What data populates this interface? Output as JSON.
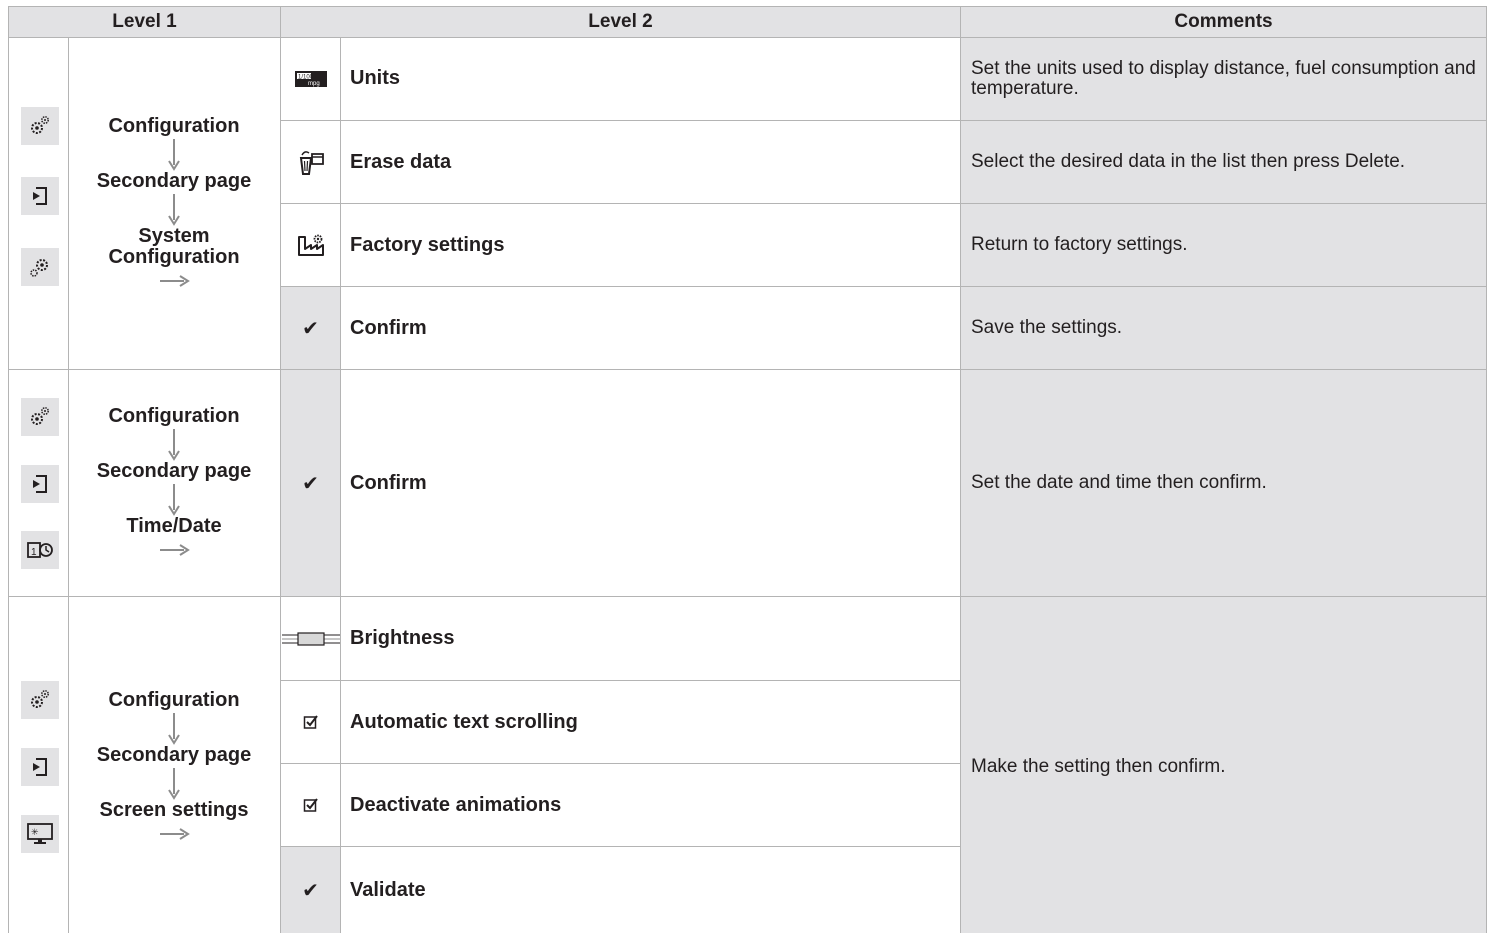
{
  "headers": {
    "level1": "Level 1",
    "level2": "Level 2",
    "comments": "Comments"
  },
  "sections": [
    {
      "path": [
        "Configuration",
        "Secondary page",
        "System Configuration"
      ],
      "icons": [
        "gear-cog-icon",
        "enter-page-icon",
        "system-gears-icon"
      ],
      "rows": [
        {
          "icon": "units-mpg-icon",
          "label": "Units"
        },
        {
          "icon": "erase-data-icon",
          "label": "Erase data"
        },
        {
          "icon": "factory-settings-icon",
          "label": "Factory settings"
        },
        {
          "icon": "check-icon",
          "label": "Confirm"
        }
      ],
      "comments": [
        "Set the units used to display distance, fuel consumption and temperature.",
        "Select the desired data in the list then press Delete.",
        "Return to factory settings.",
        "Save the settings."
      ]
    },
    {
      "path": [
        "Configuration",
        "Secondary page",
        "Time/Date"
      ],
      "icons": [
        "gear-cog-icon",
        "enter-page-icon",
        "calendar-clock-icon"
      ],
      "rows": [
        {
          "icon": "check-icon",
          "label": "Confirm"
        }
      ],
      "comments": [
        "Set the date and time then confirm."
      ]
    },
    {
      "path": [
        "Configuration",
        "Secondary page",
        "Screen settings"
      ],
      "icons": [
        "gear-cog-icon",
        "enter-page-icon",
        "screen-day-night-icon"
      ],
      "rows": [
        {
          "icon": "brightness-slider-icon",
          "label": "Brightness"
        },
        {
          "icon": "checkbox-icon",
          "label": "Automatic text scrolling"
        },
        {
          "icon": "checkbox-icon",
          "label": "Deactivate animations"
        },
        {
          "icon": "check-icon",
          "label": "Validate"
        }
      ],
      "comments": [
        "Make the setting then confirm."
      ]
    }
  ],
  "check_glyph": "✔",
  "colors": {
    "shade": "#e2e2e4",
    "grid": "#b4b4b4",
    "arrow": "#8c8c8c",
    "text": "#231f20"
  }
}
